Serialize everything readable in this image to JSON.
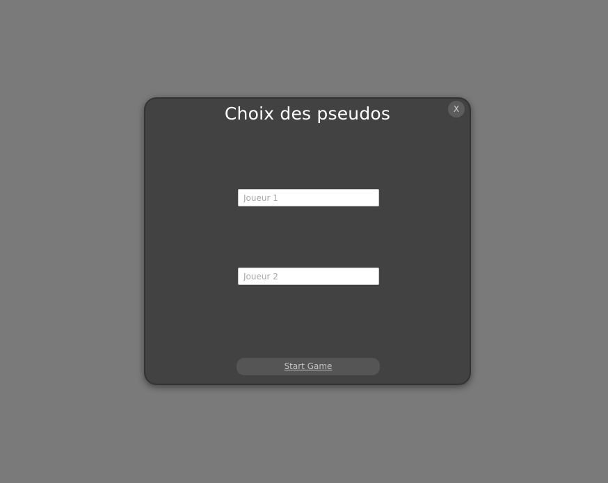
{
  "modal": {
    "title": "Choix des pseudos",
    "close_label": "X",
    "player1_placeholder": "Joueur 1",
    "player1_value": "",
    "player2_placeholder": "Joueur 2",
    "player2_value": "",
    "start_label": "Start Game"
  },
  "colors": {
    "backdrop": "#7a7a7a",
    "modal_background": "#424242",
    "button_background": "#555555",
    "title_text": "#ffffff"
  }
}
